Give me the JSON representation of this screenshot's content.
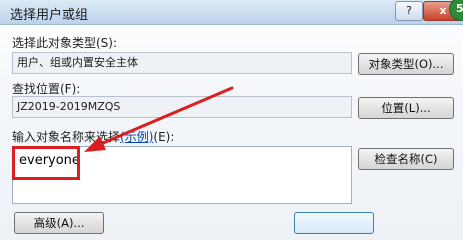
{
  "window": {
    "title": "选择用户或组",
    "help_label": "?",
    "close_label": "x",
    "badge": "5"
  },
  "object_type": {
    "label": "选择此对象类型(S):",
    "value": "用户、组或内置安全主体",
    "button": "对象类型(O)..."
  },
  "location": {
    "label": "查找位置(F):",
    "value": "JZ2019-2019MZQS",
    "button": "位置(L)..."
  },
  "names": {
    "label_prefix": "输入对象名称来选择",
    "label_link": "(示例)",
    "label_suffix": "(E):",
    "value": "everyone",
    "check_button": "检查名称(C)"
  },
  "footer": {
    "advanced_button": "高级(A)..."
  },
  "annotation": {
    "color": "#d91f1f"
  }
}
